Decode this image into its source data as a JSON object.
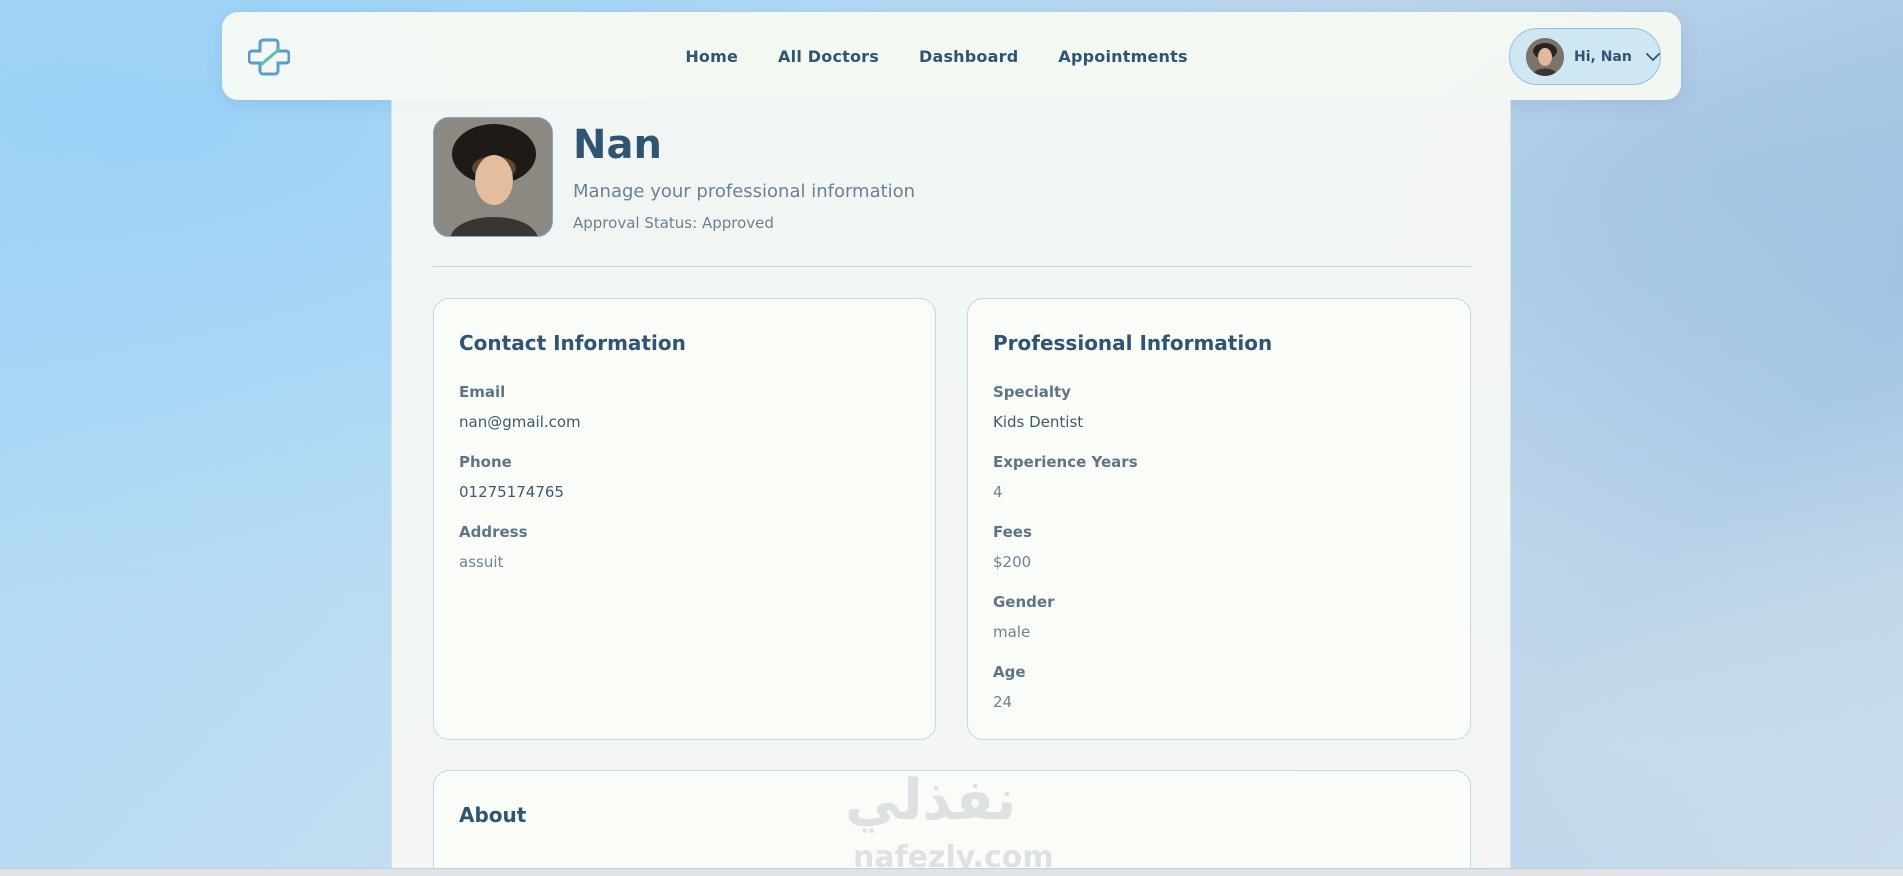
{
  "nav": {
    "links": [
      "Home",
      "All Doctors",
      "Dashboard",
      "Appointments"
    ],
    "user_greeting": "Hi, Nan"
  },
  "profile": {
    "name": "Nan",
    "subtitle": "Manage your professional information",
    "status": "Approval Status: Approved"
  },
  "contact": {
    "title": "Contact Information",
    "fields": [
      {
        "label": "Email",
        "value": "nan@gmail.com"
      },
      {
        "label": "Phone",
        "value": "01275174765"
      },
      {
        "label": "Address",
        "value": "assuit"
      }
    ]
  },
  "professional": {
    "title": "Professional Information",
    "fields": [
      {
        "label": "Specialty",
        "value": "Kids Dentist"
      },
      {
        "label": "Experience Years",
        "value": "4"
      },
      {
        "label": "Fees",
        "value": "$200"
      },
      {
        "label": "Gender",
        "value": "male"
      },
      {
        "label": "Age",
        "value": "24"
      }
    ]
  },
  "about": {
    "title": "About"
  },
  "watermark": {
    "arabic": "نفذلي",
    "latin": "nafezly.com"
  },
  "colors": {
    "primary_text": "#2f5573",
    "accent": "#8fc2de"
  }
}
